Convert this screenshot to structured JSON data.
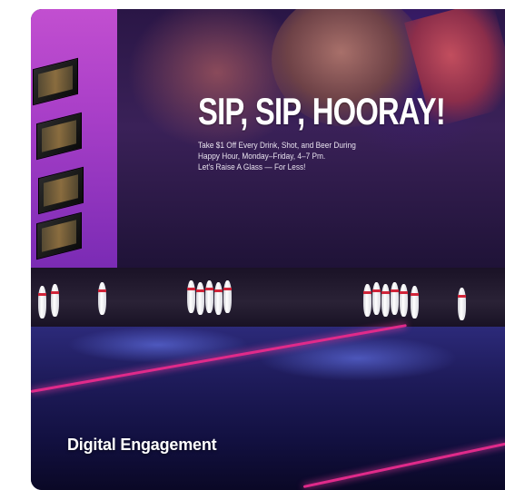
{
  "promo": {
    "title": "SIP, SIP, HOORAY!",
    "line1": "Take $1 Off Every Drink, Shot, and Beer During",
    "line2": "Happy Hour, Monday–Friday, 4–7 Pm.",
    "line3": "Let's Raise A Glass — For Less!"
  },
  "card": {
    "caption": "Digital Engagement"
  }
}
